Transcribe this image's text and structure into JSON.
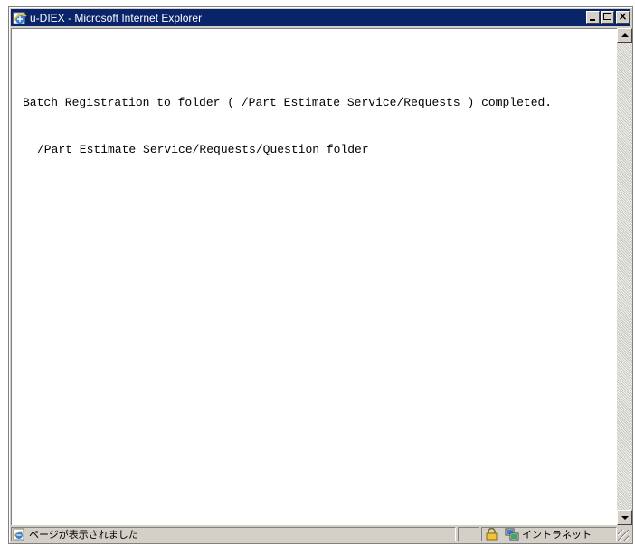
{
  "window": {
    "title": "u-DIEX - Microsoft Internet Explorer",
    "title_bar_color": "#0a246a"
  },
  "title_buttons": {
    "minimize_icon": "minimize-icon",
    "maximize_icon": "maximize-icon",
    "close_icon": "close-icon",
    "close_glyph": "×"
  },
  "content": {
    "message": "Batch Registration to folder ( /Part Estimate Service/Requests ) completed.",
    "folder_path": "/Part Estimate Service/Requests/Question folder"
  },
  "status_bar": {
    "status_text": "ページが表示されました",
    "zone_text": "イントラネット",
    "page_icon": "ie-page-icon",
    "lock_icon": "lock-icon",
    "zone_icon": "intranet-zone-icon"
  }
}
